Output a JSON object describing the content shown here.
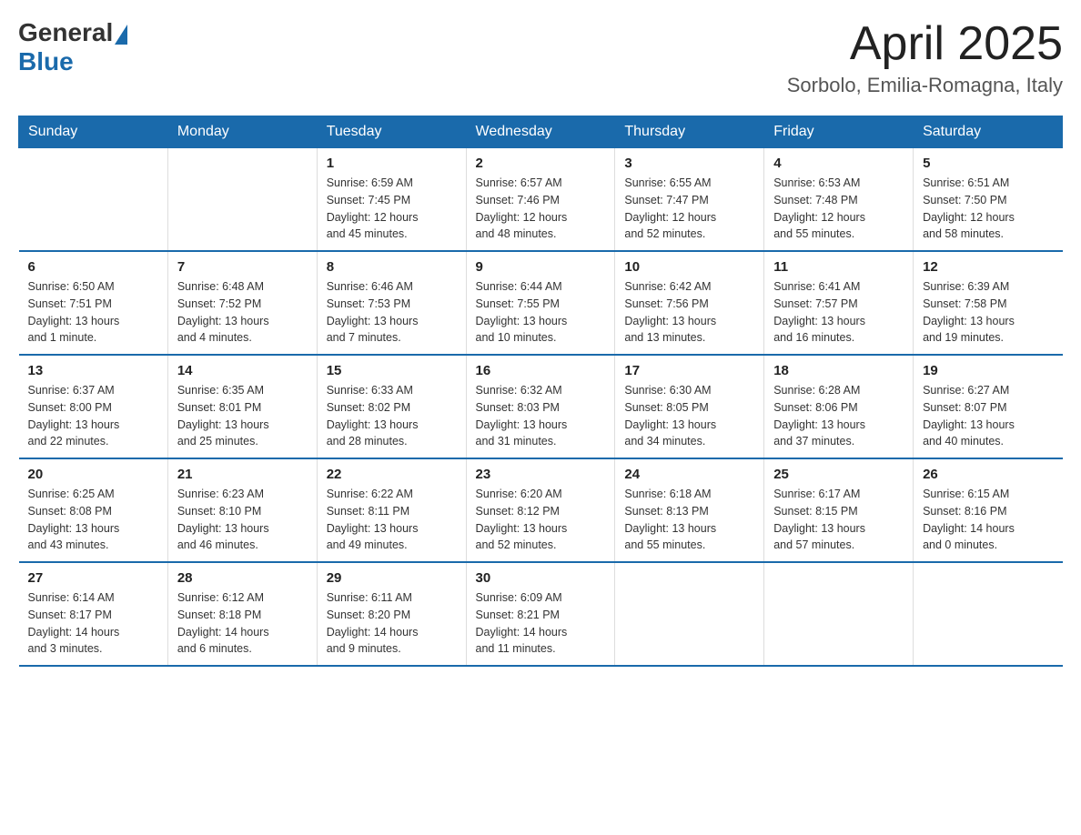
{
  "logo": {
    "general": "General",
    "blue": "Blue"
  },
  "title": "April 2025",
  "location": "Sorbolo, Emilia-Romagna, Italy",
  "weekdays": [
    "Sunday",
    "Monday",
    "Tuesday",
    "Wednesday",
    "Thursday",
    "Friday",
    "Saturday"
  ],
  "weeks": [
    [
      {
        "day": "",
        "info": ""
      },
      {
        "day": "",
        "info": ""
      },
      {
        "day": "1",
        "info": "Sunrise: 6:59 AM\nSunset: 7:45 PM\nDaylight: 12 hours\nand 45 minutes."
      },
      {
        "day": "2",
        "info": "Sunrise: 6:57 AM\nSunset: 7:46 PM\nDaylight: 12 hours\nand 48 minutes."
      },
      {
        "day": "3",
        "info": "Sunrise: 6:55 AM\nSunset: 7:47 PM\nDaylight: 12 hours\nand 52 minutes."
      },
      {
        "day": "4",
        "info": "Sunrise: 6:53 AM\nSunset: 7:48 PM\nDaylight: 12 hours\nand 55 minutes."
      },
      {
        "day": "5",
        "info": "Sunrise: 6:51 AM\nSunset: 7:50 PM\nDaylight: 12 hours\nand 58 minutes."
      }
    ],
    [
      {
        "day": "6",
        "info": "Sunrise: 6:50 AM\nSunset: 7:51 PM\nDaylight: 13 hours\nand 1 minute."
      },
      {
        "day": "7",
        "info": "Sunrise: 6:48 AM\nSunset: 7:52 PM\nDaylight: 13 hours\nand 4 minutes."
      },
      {
        "day": "8",
        "info": "Sunrise: 6:46 AM\nSunset: 7:53 PM\nDaylight: 13 hours\nand 7 minutes."
      },
      {
        "day": "9",
        "info": "Sunrise: 6:44 AM\nSunset: 7:55 PM\nDaylight: 13 hours\nand 10 minutes."
      },
      {
        "day": "10",
        "info": "Sunrise: 6:42 AM\nSunset: 7:56 PM\nDaylight: 13 hours\nand 13 minutes."
      },
      {
        "day": "11",
        "info": "Sunrise: 6:41 AM\nSunset: 7:57 PM\nDaylight: 13 hours\nand 16 minutes."
      },
      {
        "day": "12",
        "info": "Sunrise: 6:39 AM\nSunset: 7:58 PM\nDaylight: 13 hours\nand 19 minutes."
      }
    ],
    [
      {
        "day": "13",
        "info": "Sunrise: 6:37 AM\nSunset: 8:00 PM\nDaylight: 13 hours\nand 22 minutes."
      },
      {
        "day": "14",
        "info": "Sunrise: 6:35 AM\nSunset: 8:01 PM\nDaylight: 13 hours\nand 25 minutes."
      },
      {
        "day": "15",
        "info": "Sunrise: 6:33 AM\nSunset: 8:02 PM\nDaylight: 13 hours\nand 28 minutes."
      },
      {
        "day": "16",
        "info": "Sunrise: 6:32 AM\nSunset: 8:03 PM\nDaylight: 13 hours\nand 31 minutes."
      },
      {
        "day": "17",
        "info": "Sunrise: 6:30 AM\nSunset: 8:05 PM\nDaylight: 13 hours\nand 34 minutes."
      },
      {
        "day": "18",
        "info": "Sunrise: 6:28 AM\nSunset: 8:06 PM\nDaylight: 13 hours\nand 37 minutes."
      },
      {
        "day": "19",
        "info": "Sunrise: 6:27 AM\nSunset: 8:07 PM\nDaylight: 13 hours\nand 40 minutes."
      }
    ],
    [
      {
        "day": "20",
        "info": "Sunrise: 6:25 AM\nSunset: 8:08 PM\nDaylight: 13 hours\nand 43 minutes."
      },
      {
        "day": "21",
        "info": "Sunrise: 6:23 AM\nSunset: 8:10 PM\nDaylight: 13 hours\nand 46 minutes."
      },
      {
        "day": "22",
        "info": "Sunrise: 6:22 AM\nSunset: 8:11 PM\nDaylight: 13 hours\nand 49 minutes."
      },
      {
        "day": "23",
        "info": "Sunrise: 6:20 AM\nSunset: 8:12 PM\nDaylight: 13 hours\nand 52 minutes."
      },
      {
        "day": "24",
        "info": "Sunrise: 6:18 AM\nSunset: 8:13 PM\nDaylight: 13 hours\nand 55 minutes."
      },
      {
        "day": "25",
        "info": "Sunrise: 6:17 AM\nSunset: 8:15 PM\nDaylight: 13 hours\nand 57 minutes."
      },
      {
        "day": "26",
        "info": "Sunrise: 6:15 AM\nSunset: 8:16 PM\nDaylight: 14 hours\nand 0 minutes."
      }
    ],
    [
      {
        "day": "27",
        "info": "Sunrise: 6:14 AM\nSunset: 8:17 PM\nDaylight: 14 hours\nand 3 minutes."
      },
      {
        "day": "28",
        "info": "Sunrise: 6:12 AM\nSunset: 8:18 PM\nDaylight: 14 hours\nand 6 minutes."
      },
      {
        "day": "29",
        "info": "Sunrise: 6:11 AM\nSunset: 8:20 PM\nDaylight: 14 hours\nand 9 minutes."
      },
      {
        "day": "30",
        "info": "Sunrise: 6:09 AM\nSunset: 8:21 PM\nDaylight: 14 hours\nand 11 minutes."
      },
      {
        "day": "",
        "info": ""
      },
      {
        "day": "",
        "info": ""
      },
      {
        "day": "",
        "info": ""
      }
    ]
  ]
}
